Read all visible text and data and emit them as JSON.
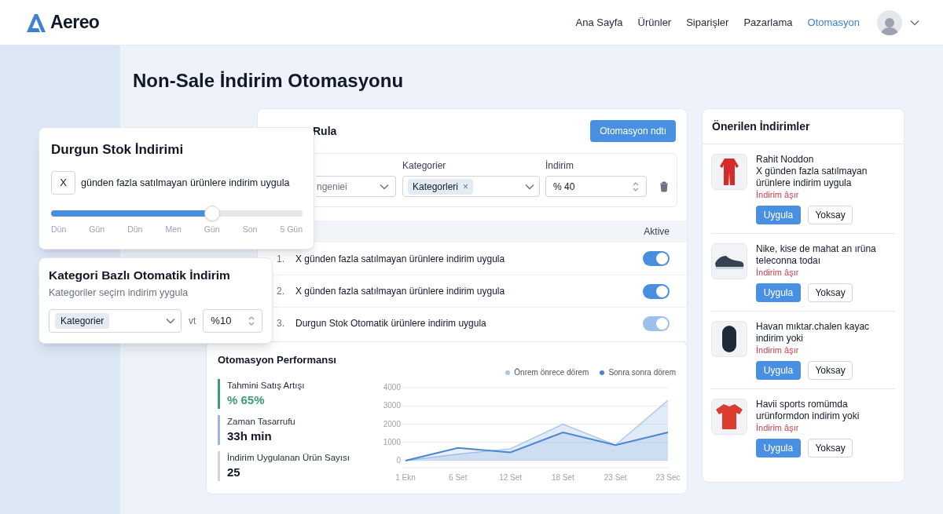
{
  "header": {
    "brand": "Aereo",
    "nav": [
      {
        "label": "Ana Sayfa",
        "selected": false
      },
      {
        "label": "Ürünler",
        "selected": false
      },
      {
        "label": "Siparişler",
        "selected": false
      },
      {
        "label": "Pazarlama",
        "selected": false
      },
      {
        "label": "Otomasyon",
        "selected": true
      }
    ]
  },
  "page_title": "Non-Sale İndirim Otomasyonu",
  "rules_card": {
    "title": "Rula",
    "button": "Otomasyon ndtı",
    "fields": [
      {
        "kind": "select",
        "value": "ngeniei"
      },
      {
        "kind": "chips",
        "label": "Kategorier",
        "chip": "Kategorleri",
        "chip_remove": "×"
      },
      {
        "kind": "number",
        "label": "İndirim",
        "value": "% 40"
      }
    ],
    "table_header": "Aktive",
    "rules": [
      {
        "number": "1.",
        "text": "X günden fazla satılmayan ürünlere indirim uygula",
        "on": true,
        "disabled": false
      },
      {
        "number": "2.",
        "text": "X günden fazla satılmayan ürünlere indirim uygula",
        "on": true,
        "disabled": false
      },
      {
        "number": "3.",
        "text": "Durgun Stok Otomatik ürünlere indirim uygula",
        "on": true,
        "disabled": true
      }
    ]
  },
  "performance": {
    "title": "Otomasyon Performansı",
    "stats": [
      {
        "label": "Tahmini Satış Artışı",
        "value": "% 65%",
        "color": "#3a9d6e",
        "highlight": true
      },
      {
        "label": "Zaman Tasarrufu",
        "value": "33h min",
        "color": "#9bb8e0",
        "highlight": false
      },
      {
        "label": "İndirim Uygulanan Ürün Sayısı",
        "value": "25",
        "color": "#d1d5db",
        "highlight": false
      }
    ],
    "chart_data": {
      "type": "area",
      "categories": [
        "1 Ekn",
        "6 Set",
        "12 Set",
        "18 Set",
        "23 Set",
        "23 Sec"
      ],
      "series": [
        {
          "name": "Önrem önrece dörem",
          "color": "#a9c6ec",
          "values": [
            0,
            350,
            650,
            2000,
            850,
            3300
          ]
        },
        {
          "name": "Sonra sonra dörem",
          "color": "#4a86d0",
          "values": [
            0,
            700,
            450,
            1550,
            850,
            1550
          ]
        }
      ],
      "ylim": [
        0,
        4000
      ],
      "legend": "top-right",
      "grid": true,
      "yticks": [
        0,
        1000,
        2000,
        3000,
        4000
      ]
    }
  },
  "suggestions": {
    "title": "Önerilen İndirimler",
    "items": [
      {
        "title": "Rahit Noddon",
        "text": "X günden fazla satılmayan ürünlere indirim uygula",
        "note": "İndirim âşır",
        "apply": "Uygula",
        "ignore": "Yoksay"
      },
      {
        "text": "Nike, kise de mahat an ırüna teleconna todaı",
        "note": "İndirim âşır",
        "apply": "Uygula",
        "ignore": "Yoksay"
      },
      {
        "text": "Havan mıktar.chalen kayac indirim yoki",
        "note": "İndirim âşır",
        "apply": "Uygula",
        "ignore": "Yoksay"
      },
      {
        "text": "Havii sports romümda urünformdon indirim yoki",
        "note": "İndirim âşır",
        "apply": "Uygula",
        "ignore": "Yoksay"
      }
    ]
  },
  "stock_card": {
    "title": "Durgun Stok İndirimi",
    "input": "X",
    "text": "günden fazla satılmayan ürünlere indirim uygula",
    "level": 0.64,
    "scale": [
      "Dün",
      "Gün",
      "Dün",
      "Men",
      "Gün",
      "Son",
      "5 Gün"
    ]
  },
  "category_card": {
    "title": "Kategori Bazlı Otomatik İndirim",
    "subtitle": "Kategoriler seçirn indirim yygula",
    "chip": "Kategorier",
    "joiner": "vt",
    "value": "%10"
  }
}
